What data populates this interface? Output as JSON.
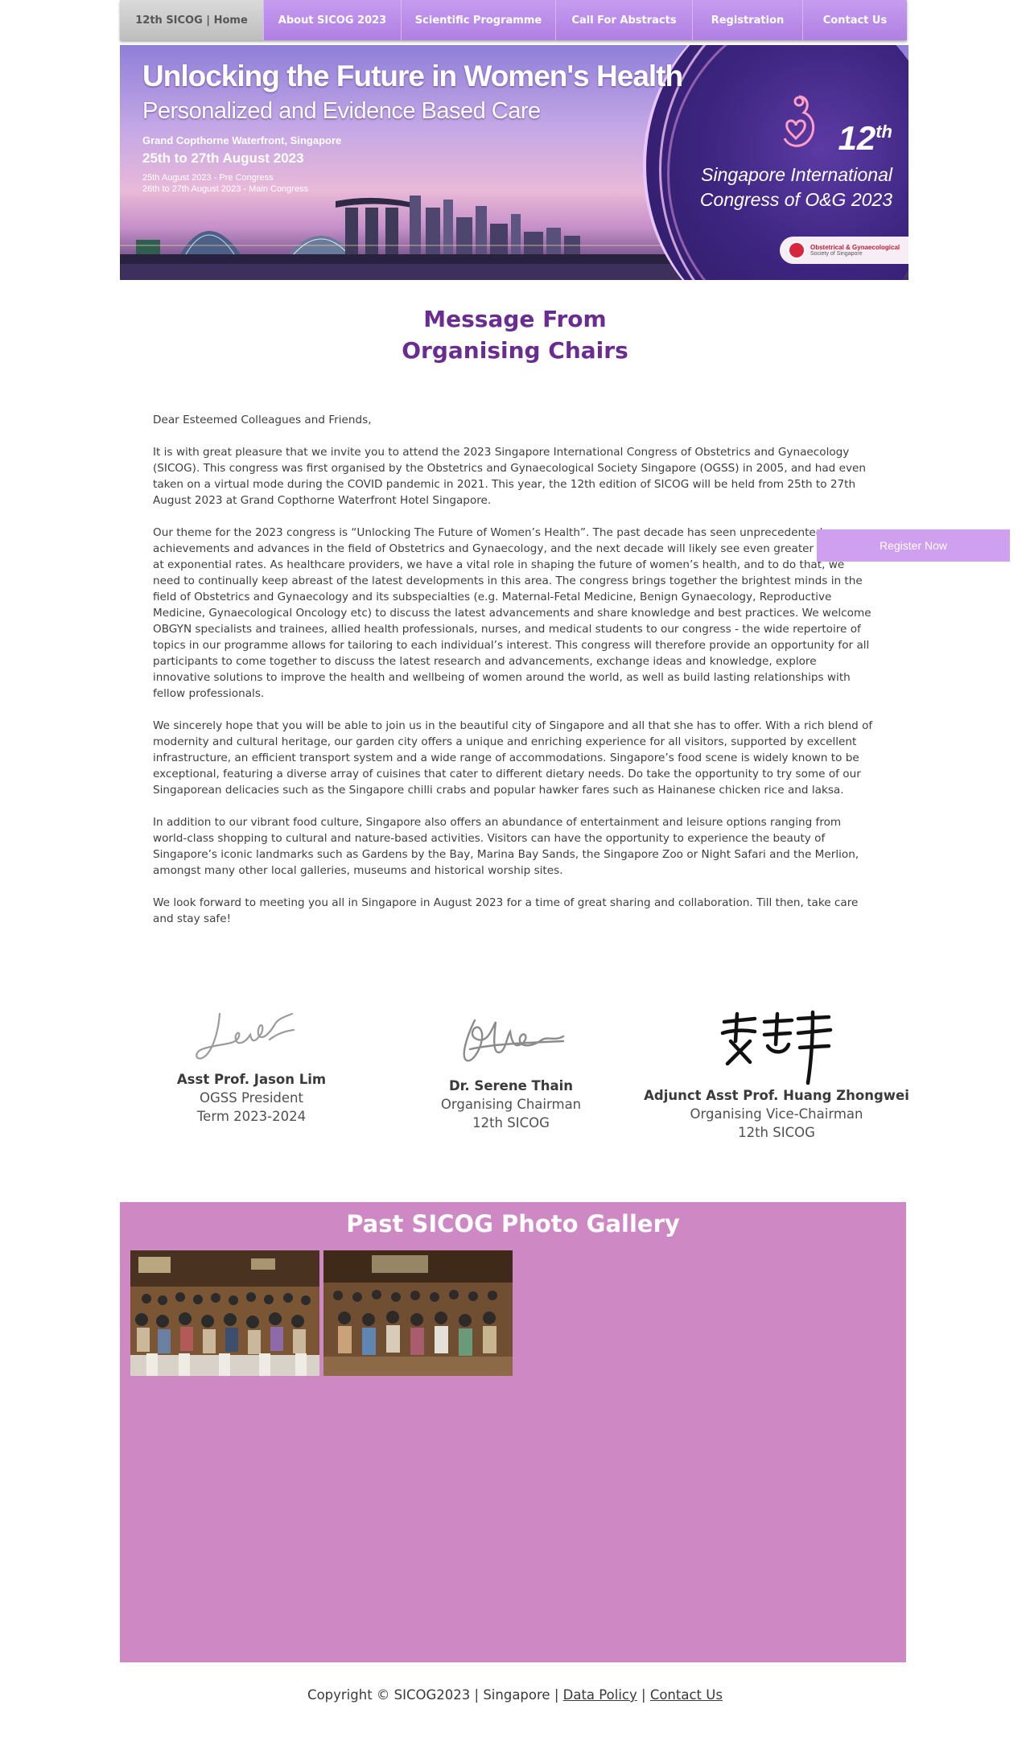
{
  "nav": {
    "items": [
      {
        "label": "12th SICOG | Home"
      },
      {
        "label": "About SICOG 2023"
      },
      {
        "label": "Scientific Programme"
      },
      {
        "label": "Call For Abstracts"
      },
      {
        "label": "Registration"
      },
      {
        "label": "Contact Us"
      }
    ]
  },
  "banner": {
    "headline": "Unlocking the Future in Women's Health",
    "subheadline": "Personalized and Evidence Based Care",
    "venue": "Grand Copthorne Waterfront, Singapore",
    "dates": "25th to 27th August 2023",
    "pre_congress": "25th August 2023 - Pre Congress",
    "main_congress": "26th to 27th August 2023 - Main Congress",
    "edition_number": "12",
    "edition_suffix": "th",
    "congress_name_line1": "Singapore International",
    "congress_name_line2": "Congress of O&G 2023",
    "society_line1": "Obstetrical & Gynaecological",
    "society_line2": "Society of Singapore"
  },
  "heading": {
    "line1": "Message From",
    "line2": "Organising Chairs"
  },
  "letter": {
    "paragraphs": [
      "Dear Esteemed Colleagues and Friends,",
      "It is with great pleasure that we invite you to attend the 2023 Singapore International Congress of Obstetrics and Gynaecology (SICOG). This congress was first organised by the Obstetrics and Gynaecological Society Singapore (OGSS) in 2005, and had even taken on a virtual mode during the COVID pandemic in 2021. This year, the 12th edition of SICOG will be held from 25th to 27th August 2023 at Grand Copthorne Waterfront Hotel Singapore.",
      "Our theme for the 2023 congress is “Unlocking The Future of Women’s Health”. The past decade has seen unprecedented achievements and advances in the field of Obstetrics and Gynaecology, and the next decade will likely see even greater progress at exponential rates. As healthcare providers, we have a vital role in shaping the future of women’s health, and to do that, we need to continually keep abreast of the latest developments in this area. The congress brings together the brightest minds in the field of Obstetrics and Gynaecology and its subspecialties (e.g. Maternal-Fetal Medicine, Benign Gynaecology, Reproductive Medicine, Gynaecological Oncology etc) to discuss the latest advancements and share knowledge and best practices. We welcome OBGYN specialists and trainees, allied health professionals, nurses, and medical students to our congress - the wide repertoire of topics in our programme allows for tailoring to each individual’s interest. This congress will therefore provide an opportunity for all participants to come together to discuss the latest research and advancements, exchange ideas and knowledge, explore innovative solutions to improve the health and wellbeing of women around the world, as well as build lasting relationships with fellow professionals.",
      "We sincerely hope that you will be able to join us in the beautiful city of Singapore and all that she has to offer. With a rich blend of modernity and cultural heritage, our garden city offers a unique and enriching experience for all visitors, supported by excellent infrastructure, an efficient transport system and a wide range of accommodations. Singapore’s food scene is widely known to be exceptional, featuring a diverse array of cuisines that cater to different dietary needs. Do take the opportunity to try some of our Singaporean delicacies such as the Singapore chilli crabs and popular hawker fares such as Hainanese chicken rice and laksa.",
      "In addition to our vibrant food culture, Singapore also offers an abundance of entertainment and leisure options ranging from world-class shopping to cultural and nature-based activities. Visitors can have the opportunity to experience the beauty of Singapore’s iconic landmarks such as Gardens by the Bay, Marina Bay Sands, the Singapore Zoo or Night Safari and the Merlion, amongst many other local galleries, museums and historical worship sites.",
      "We look forward to meeting you all in Singapore in August 2023 for a time of great sharing and collaboration. Till then, take care and stay safe!"
    ]
  },
  "register_button": {
    "label": "Register Now"
  },
  "signatories": [
    {
      "name": "Asst Prof. Jason Lim",
      "role": "OGSS President",
      "detail": "Term 2023-2024"
    },
    {
      "name": "Dr. Serene Thain",
      "role": "Organising Chairman",
      "detail": "12th SICOG"
    },
    {
      "name": "Adjunct Asst Prof. Huang Zhongwei",
      "role": "Organising Vice-Chairman",
      "detail": "12th SICOG"
    }
  ],
  "gallery": {
    "title": "Past SICOG Photo Gallery",
    "photo_count": 2
  },
  "footer": {
    "copyright": "Copyright © SICOG2023 | Singapore |",
    "separator": "|",
    "data_policy": "Data Policy",
    "contact_us": "Contact Us"
  },
  "colors": {
    "nav_bg": "#b98aea",
    "heading": "#6a2c91",
    "gallery_bg": "#ce89c4",
    "register_bg": "#cf9ff0"
  }
}
